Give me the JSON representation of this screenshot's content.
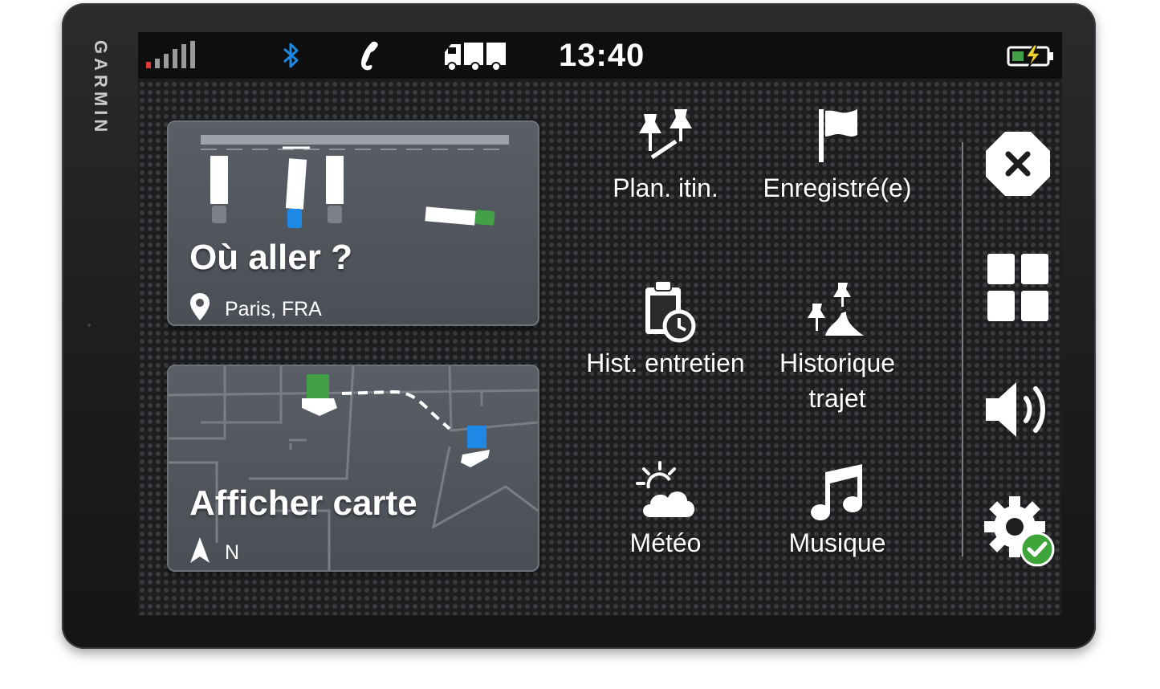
{
  "device": {
    "brand": "GARMIN"
  },
  "status": {
    "time": "13:40",
    "icons": [
      "signal-icon",
      "bluetooth-icon",
      "phone-icon",
      "truck-icon",
      "battery-charging-icon"
    ]
  },
  "cards": {
    "where_to": {
      "title": "Où aller ?",
      "location": "Paris, FRA"
    },
    "view_map": {
      "title": "Afficher carte",
      "heading": "N"
    }
  },
  "apps": {
    "trip_planner": "Plan. itin.",
    "saved": "Enregistré(e)",
    "service_history": "Hist. entretien",
    "trip_history_line1": "Historique",
    "trip_history_line2": "trajet",
    "weather": "Météo",
    "music": "Musique"
  },
  "sidebar": {
    "buttons": [
      "close-icon",
      "apps-grid-icon",
      "volume-icon",
      "settings-icon"
    ]
  },
  "colors": {
    "accent_blue": "#1e88e5",
    "accent_green": "#43a047",
    "signal_red": "#e53935",
    "status_ok_green": "#3ea53a"
  }
}
